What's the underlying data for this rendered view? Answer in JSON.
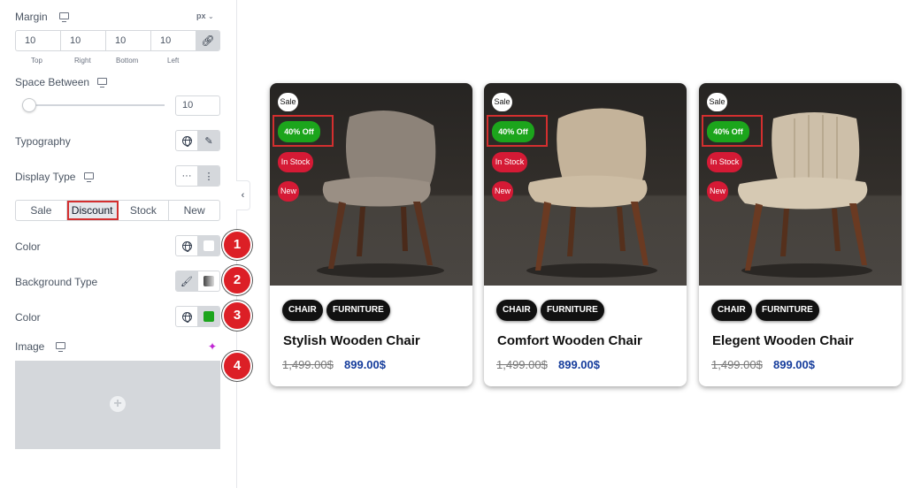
{
  "panel": {
    "margin": {
      "label": "Margin",
      "unit": "px",
      "values": [
        "10",
        "10",
        "10",
        "10"
      ],
      "sides": [
        "Top",
        "Right",
        "Bottom",
        "Left"
      ]
    },
    "space_between": {
      "label": "Space Between",
      "value": "10",
      "level": 0.05
    },
    "typography": {
      "label": "Typography"
    },
    "display_type": {
      "label": "Display Type",
      "tabs": [
        "Sale",
        "Discount",
        "Stock",
        "New"
      ],
      "active": "Discount"
    },
    "color1": {
      "label": "Color",
      "value": "#ffffff"
    },
    "background_type": {
      "label": "Background Type"
    },
    "color2": {
      "label": "Color",
      "value": "#1ca51c"
    },
    "image": {
      "label": "Image"
    },
    "markers": [
      "1",
      "2",
      "3",
      "4"
    ]
  },
  "cards": [
    {
      "badges": {
        "sale": "Sale",
        "discount": "40% Off",
        "stock": "In Stock",
        "new": "New"
      },
      "tags": [
        "CHAIR",
        "FURNITURE"
      ],
      "title": "Stylish Wooden Chair",
      "old_price": "1,499.00$",
      "price": "899.00$",
      "chair_color": "#8d8379"
    },
    {
      "badges": {
        "sale": "Sale",
        "discount": "40% Off",
        "stock": "In Stock",
        "new": "New"
      },
      "tags": [
        "CHAIR",
        "FURNITURE"
      ],
      "title": "Comfort Wooden Chair",
      "old_price": "1,499.00$",
      "price": "899.00$",
      "chair_color": "#c4b39a"
    },
    {
      "badges": {
        "sale": "Sale",
        "discount": "40% Off",
        "stock": "In Stock",
        "new": "New"
      },
      "tags": [
        "CHAIR",
        "FURNITURE"
      ],
      "title": "Elegent Wooden Chair",
      "old_price": "1,499.00$",
      "price": "899.00$",
      "chair_color": "#cdbfa9"
    }
  ],
  "colors": {
    "discount_badge": "#1ca51c",
    "badge_red": "#d51a35",
    "highlight": "#d32f2f",
    "price_blue": "#163d9c"
  }
}
